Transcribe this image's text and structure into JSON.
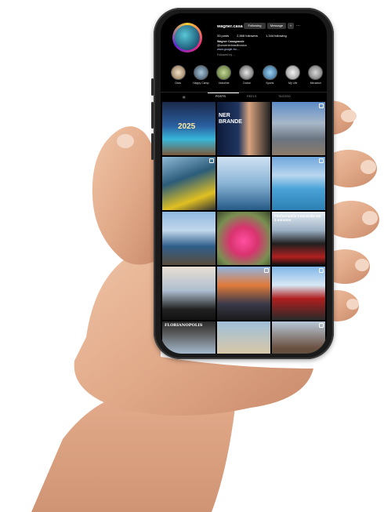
{
  "profile": {
    "username": "wagner.casa",
    "following_label": "Following",
    "message_label": "Message",
    "stats": {
      "posts": "33 posts",
      "followers": "2,568 followers",
      "following": "1,344 following"
    },
    "bio_name": "Wagner Casagrande",
    "bio_line": "@umcerterbrasilinosica",
    "bio_link": "www.google-for-...",
    "followed_by": "Followed by ..."
  },
  "highlights": [
    {
      "label": "Citas"
    },
    {
      "label": "Happy Camp"
    },
    {
      "label": "Valvoline"
    },
    {
      "label": "Dubai"
    },
    {
      "label": "Sports"
    },
    {
      "label": "My Life"
    },
    {
      "label": "Meuseuh"
    }
  ],
  "tabs": [
    {
      "label": "POSTS"
    },
    {
      "label": "REELS"
    },
    {
      "label": "TAGGED"
    }
  ],
  "posts": [
    {
      "overlay": "2025"
    },
    {
      "overlay": "NER BRANDE"
    },
    {
      "overlay": ""
    },
    {
      "overlay": ""
    },
    {
      "overlay": ""
    },
    {
      "overlay": ""
    },
    {
      "overlay": ""
    },
    {
      "overlay": ""
    },
    {
      "overlay": "Florianópolis Concordia em 3 minutos"
    },
    {
      "overlay": ""
    },
    {
      "overlay": ""
    },
    {
      "overlay": ""
    },
    {
      "overlay": "FLORIANOPOLIS"
    },
    {
      "overlay": ""
    },
    {
      "overlay": ""
    }
  ],
  "colors": {
    "screen_bg": "#000000",
    "story_ring": "#ee2a7b",
    "skin": "#e7b393",
    "phone_frame": "#1a1a1a"
  },
  "icons": [
    "more-icon",
    "add-user-icon",
    "grid-icon",
    "reels-icon",
    "tagged-icon",
    "carousel-icon"
  ]
}
